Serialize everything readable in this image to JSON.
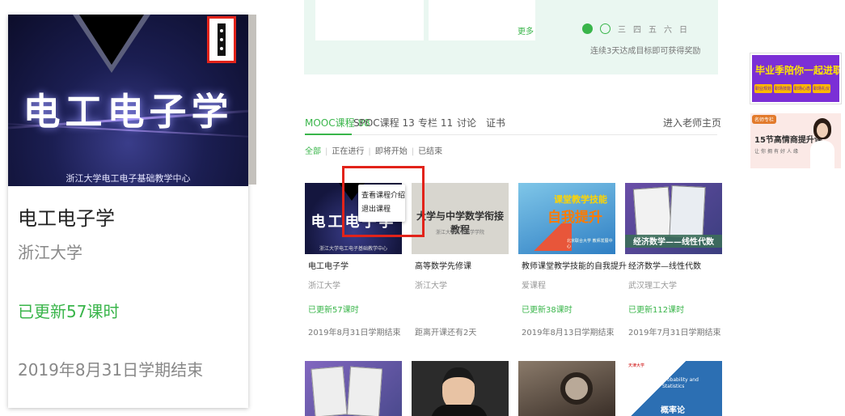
{
  "zoom_card": {
    "thumb_title": "电工电子学",
    "thumb_subtitle": "浙江大学电工电子基础教学中心",
    "name": "电工电子学",
    "school": "浙江大学",
    "update": "已更新57课时",
    "end": "2019年8月31日学期结束"
  },
  "top_panel": {
    "more_label": "更多",
    "day_labels": [
      "三",
      "四",
      "五",
      "六",
      "日"
    ],
    "checkin_tip": "连续3天达成目标即可获得奖励"
  },
  "tabs": [
    {
      "label": "MOOC课程 88"
    },
    {
      "label": "SPOC课程 13"
    },
    {
      "label": "专栏 11"
    },
    {
      "label": "讨论"
    },
    {
      "label": "证书"
    }
  ],
  "teacher_home_label": "进入老师主页",
  "filters": [
    {
      "label": "全部"
    },
    {
      "label": "正在进行"
    },
    {
      "label": "即将开始"
    },
    {
      "label": "已结束"
    }
  ],
  "courses": [
    {
      "thumb_title": "电工电子学",
      "thumb_sub": "浙江大学电工电子基础教学中心",
      "name": "电工电子学",
      "school": "浙江大学",
      "update": "已更新57课时",
      "end": "2019年8月31日学期结束"
    },
    {
      "thumb_title": "大学与中学数学衔接教程",
      "thumb_sub": "浙江大学数学科学学院",
      "name": "高等数学先修课",
      "school": "浙江大学",
      "update": "",
      "end": "距离开课还有2天"
    },
    {
      "thumb_title": "课堂教学技能",
      "thumb_big": "自我提升",
      "thumb_sub": "北京联合大学 教师发展中心",
      "name": "教师课堂教学技能的自我提升",
      "school": "爱课程",
      "update": "已更新38课时",
      "end": "2019年8月13日学期结束"
    },
    {
      "thumb_title": "经济数学——线性代数",
      "name": "经济数学—线性代数",
      "school": "武汉理工大学",
      "update": "已更新112课时",
      "end": "2019年7月31日学期结束"
    }
  ],
  "row2": {
    "stats_logo": "天津大学",
    "stats_title": "Probability and Statistics",
    "stats_big": "概率论"
  },
  "popup_menu": {
    "items": [
      "查看课程介绍",
      "退出课程"
    ]
  },
  "ads": {
    "graduate_title": "毕业季陪你一起进职场",
    "graduate_tags": [
      "职业规划",
      "职场技能",
      "职场心态",
      "职场礼仪"
    ],
    "eq_badge": "名师专栏",
    "eq_title": "15节高情商提升课",
    "eq_sub": "让你拥有好人缘"
  },
  "colors": {
    "accent_green": "#39b54a",
    "highlight_red": "#e2231a",
    "panel_mint": "#eaf7f1"
  }
}
